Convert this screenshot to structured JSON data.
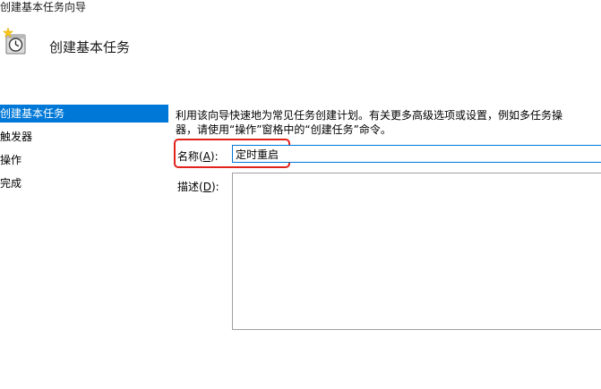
{
  "window": {
    "title": "创建基本任务向导"
  },
  "header": {
    "icon": "clock-task-icon",
    "title": "创建基本任务"
  },
  "steps": [
    {
      "label": "创建基本任务",
      "active": true
    },
    {
      "label": "触发器",
      "active": false
    },
    {
      "label": "操作",
      "active": false
    },
    {
      "label": "完成",
      "active": false
    }
  ],
  "description": {
    "line1": "利用该向导快速地为常见任务创建计划。有关更多高级选项或设置，例如多任务操",
    "line2": "器，请使用“操作”窗格中的“创建任务”命令。"
  },
  "form": {
    "name_label": "名称(",
    "name_accel": "A",
    "name_label_end": "):",
    "name_value": "定时重启",
    "desc_label": "描述(",
    "desc_accel": "D",
    "desc_label_end": "):",
    "desc_value": ""
  },
  "colors": {
    "selection": "#0078d7",
    "highlight": "#e2231a"
  }
}
